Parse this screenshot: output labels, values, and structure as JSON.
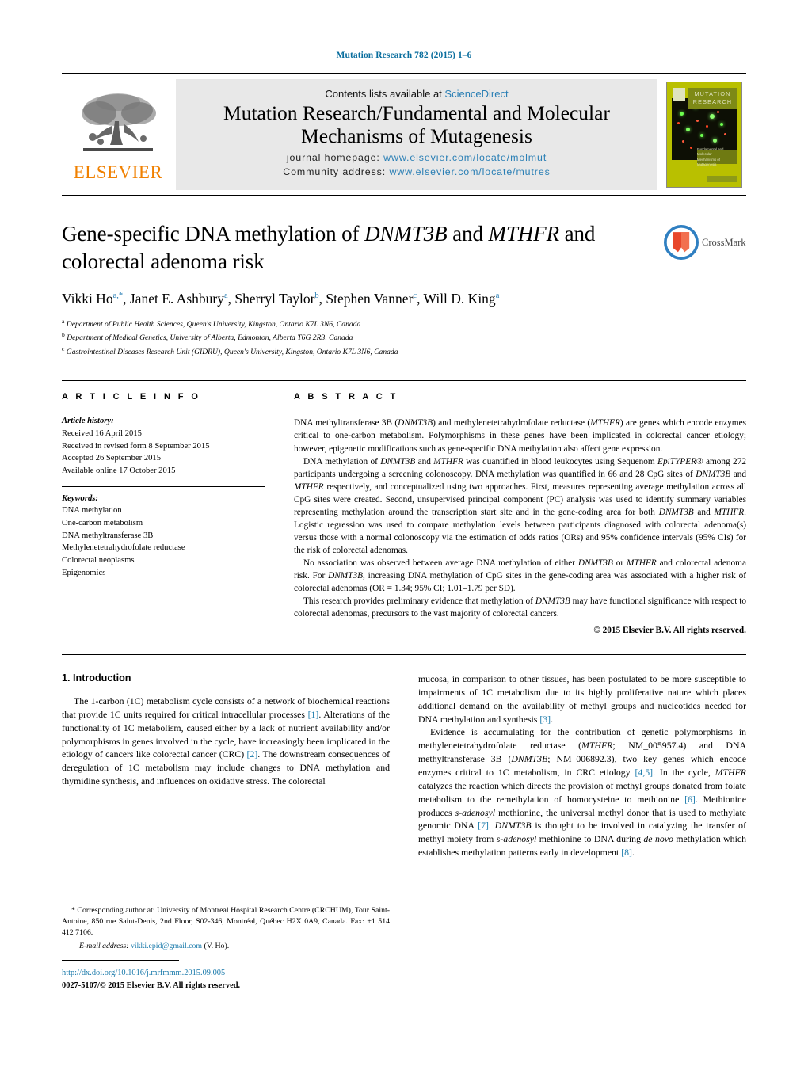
{
  "running_head": "Mutation Research 782 (2015) 1–6",
  "masthead": {
    "publisher_logo_text": "ELSEVIER",
    "contents_prefix": "Contents lists available at ",
    "contents_link": "ScienceDirect",
    "journal_title_line1": "Mutation Research/Fundamental and Molecular",
    "journal_title_line2": "Mechanisms of Mutagenesis",
    "homepage_label": "journal homepage:",
    "homepage_url": "www.elsevier.com/locate/molmut",
    "community_label": "Community address:",
    "community_url": "www.elsevier.com/locate/mutres",
    "cover": {
      "band_line1": "MUTATION",
      "band_line2": "RESEARCH",
      "sub_line1": "Fundamental and Molecular",
      "sub_line2": "Mechanisms of Mutagenesis"
    }
  },
  "article": {
    "title_part1": "Gene-specific DNA methylation of ",
    "title_gene1": "DNMT3B",
    "title_part2": " and ",
    "title_gene2": "MTHFR",
    "title_part3": " and colorectal adenoma risk",
    "crossmark_label": "CrossMark",
    "authors": "Vikki Ho, Janet E. Ashbury, Sherryl Taylor, Stephen Vanner, Will D. King",
    "author_list": [
      {
        "name": "Vikki Ho",
        "sup": "a,*"
      },
      {
        "name": "Janet E. Ashbury",
        "sup": "a"
      },
      {
        "name": "Sherryl Taylor",
        "sup": "b"
      },
      {
        "name": "Stephen Vanner",
        "sup": "c"
      },
      {
        "name": "Will D. King",
        "sup": "a"
      }
    ],
    "affiliations": [
      {
        "mark": "a",
        "text": "Department of Public Health Sciences, Queen's University, Kingston, Ontario K7L 3N6, Canada"
      },
      {
        "mark": "b",
        "text": "Department of Medical Genetics, University of Alberta, Edmonton, Alberta T6G 2R3, Canada"
      },
      {
        "mark": "c",
        "text": "Gastrointestinal Diseases Research Unit (GIDRU), Queen's University, Kingston, Ontario K7L 3N6, Canada"
      }
    ]
  },
  "article_info": {
    "heading": "A R T I C L E   I N F O",
    "history_label": "Article history:",
    "history": [
      "Received 16 April 2015",
      "Received in revised form 8 September 2015",
      "Accepted 26 September 2015",
      "Available online 17 October 2015"
    ],
    "keywords_label": "Keywords:",
    "keywords": [
      "DNA methylation",
      "One-carbon metabolism",
      "DNA methyltransferase 3B",
      "Methylenetetrahydrofolate reductase",
      "Colorectal neoplasms",
      "Epigenomics"
    ]
  },
  "abstract": {
    "heading": "A B S T R A C T",
    "paragraphs": [
      "DNA methyltransferase 3B (DNMT3B) and methylenetetrahydrofolate reductase (MTHFR) are genes which encode enzymes critical to one-carbon metabolism. Polymorphisms in these genes have been implicated in colorectal cancer etiology; however, epigenetic modifications such as gene-specific DNA methylation also affect gene expression.",
      "DNA methylation of DNMT3B and MTHFR was quantified in blood leukocytes using Sequenom EpiTYPER® among 272 participants undergoing a screening colonoscopy. DNA methylation was quantified in 66 and 28 CpG sites of DNMT3B and MTHFR respectively, and conceptualized using two approaches. First, measures representing average methylation across all CpG sites were created. Second, unsupervised principal component (PC) analysis was used to identify summary variables representing methylation around the transcription start site and in the gene-coding area for both DNMT3B and MTHFR. Logistic regression was used to compare methylation levels between participants diagnosed with colorectal adenoma(s) versus those with a normal colonoscopy via the estimation of odds ratios (ORs) and 95% confidence intervals (95% CIs) for the risk of colorectal adenomas.",
      "No association was observed between average DNA methylation of either DNMT3B or MTHFR and colorectal adenoma risk. For DNMT3B, increasing DNA methylation of CpG sites in the gene-coding area was associated with a higher risk of colorectal adenomas (OR = 1.34; 95% CI; 1.01–1.79 per SD).",
      "This research provides preliminary evidence that methylation of DNMT3B may have functional significance with respect to colorectal adenomas, precursors to the vast majority of colorectal cancers."
    ],
    "copyright": "© 2015 Elsevier B.V. All rights reserved."
  },
  "introduction": {
    "heading": "1.  Introduction",
    "left_paragraph": "The 1-carbon (1C) metabolism cycle consists of a network of biochemical reactions that provide 1C units required for critical intracellular processes [1]. Alterations of the functionality of 1C metabolism, caused either by a lack of nutrient availability and/or polymorphisms in genes involved in the cycle, have increasingly been implicated in the etiology of cancers like colorectal cancer (CRC) [2]. The downstream consequences of deregulation of 1C metabolism may include changes to DNA methylation and thymidine synthesis, and influences on oxidative stress. The colorectal",
    "right_paragraph_1": "mucosa, in comparison to other tissues, has been postulated to be more susceptible to impairments of 1C metabolism due to its highly proliferative nature which places additional demand on the availability of methyl groups and nucleotides needed for DNA methylation and synthesis [3].",
    "right_paragraph_2": "Evidence is accumulating for the contribution of genetic polymorphisms in methylenetetrahydrofolate reductase (MTHFR; NM_005957.4) and DNA methyltransferase 3B (DNMT3B; NM_006892.3), two key genes which encode enzymes critical to 1C metabolism, in CRC etiology [4,5]. In the cycle, MTHFR catalyzes the reaction which directs the provision of methyl groups donated from folate metabolism to the remethylation of homocysteine to methionine [6]. Methionine produces s-adenosyl methionine, the universal methyl donor that is used to methylate genomic DNA [7]. DNMT3B is thought to be involved in catalyzing the transfer of methyl moiety from s-adenosyl methionine to DNA during de novo methylation which establishes methylation patterns early in development [8]."
  },
  "footnote": {
    "corresponding": "* Corresponding author at: University of Montreal Hospital Research Centre (CRCHUM), Tour Saint-Antoine, 850 rue Saint-Denis, 2nd Floor, S02-346, Montréal, Québec H2X 0A9, Canada. Fax: +1 514 412 7106.",
    "email_label": "E-mail address:",
    "email": "vikki.epid@gmail.com",
    "email_suffix": " (V. Ho).",
    "doi": "http://dx.doi.org/10.1016/j.mrfmmm.2015.09.005",
    "issn": "0027-5107/© 2015 Elsevier B.V. All rights reserved."
  },
  "colors": {
    "link": "#2a7fb5",
    "reference": "#1a7aab",
    "elsevier_orange": "#f08000",
    "cover_green": "#b9c000"
  }
}
